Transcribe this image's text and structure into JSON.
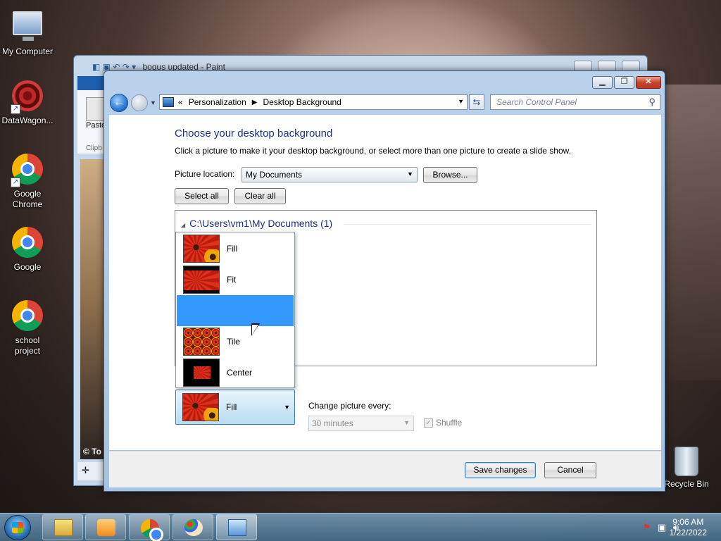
{
  "desktop": {
    "icons": [
      {
        "label": "My Computer"
      },
      {
        "label": "DataWagon..."
      },
      {
        "label": "Google Chrome"
      },
      {
        "label": "Google"
      },
      {
        "label": "school project"
      },
      {
        "label": "Recycle Bin"
      }
    ]
  },
  "paint": {
    "title": "bogus updated - Paint",
    "paste_label": "Paste",
    "clipboard_label": "Clipb",
    "canvas_text": "© To"
  },
  "window": {
    "address": {
      "chevron": "«",
      "crumbs": [
        "Personalization",
        "Desktop Background"
      ]
    },
    "search_placeholder": "Search Control Panel",
    "title": "Choose your desktop background",
    "description": "Click a picture to make it your desktop background, or select more than one picture to create a slide show.",
    "picture_location_label": "Picture location:",
    "picture_location_value": "My Documents",
    "browse_label": "Browse...",
    "select_all_label": "Select all",
    "clear_all_label": "Clear all",
    "gallery_group": "C:\\Users\\vm1\\My Documents (1)",
    "position_options": [
      {
        "label": "Fill"
      },
      {
        "label": "Fit"
      },
      {
        "label": ""
      },
      {
        "label": "Tile"
      },
      {
        "label": "Center"
      }
    ],
    "highlighted_option_index": 2,
    "position_selected": "Fill",
    "change_picture_label": "Change picture every:",
    "change_picture_value": "30 minutes",
    "shuffle_label": "Shuffle",
    "shuffle_checked": true,
    "save_label": "Save changes",
    "cancel_label": "Cancel"
  },
  "taskbar": {
    "time": "9:06 AM",
    "date": "1/22/2022"
  },
  "colors": {
    "selection": "#3399ff",
    "heading": "#1e3287"
  }
}
